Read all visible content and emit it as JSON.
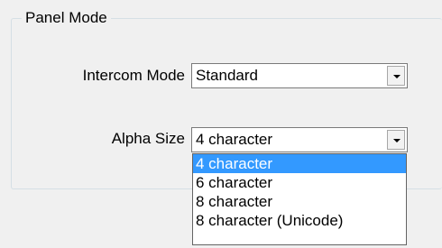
{
  "panel": {
    "title": "Panel Mode",
    "intercom_mode": {
      "label": "Intercom Mode",
      "value": "Standard"
    },
    "alpha_size": {
      "label": "Alpha Size",
      "value": "4 character",
      "options": [
        "4 character",
        "6 character",
        "8 character",
        "8 character (Unicode)"
      ],
      "highlighted_index": 0
    }
  },
  "colors": {
    "highlight": "#3399ff",
    "window_bg": "#f0f0f0"
  },
  "icons": {
    "dropdown_arrow": "chevron-down-icon"
  }
}
